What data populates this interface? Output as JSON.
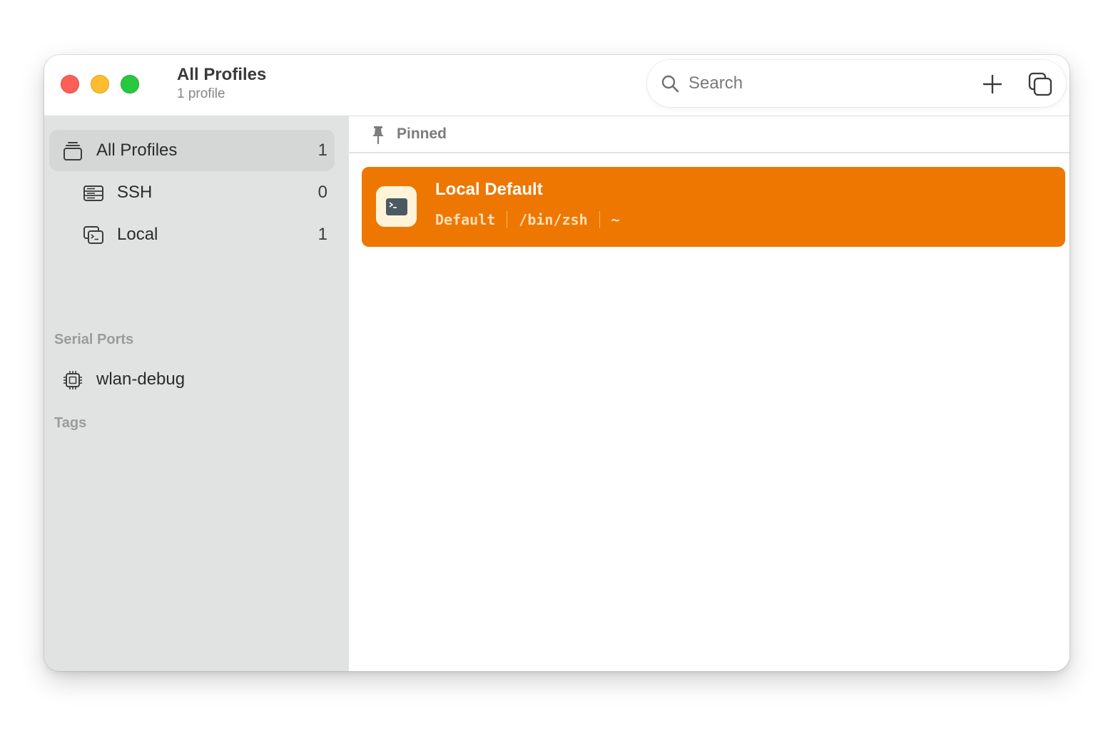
{
  "window": {
    "title": "All Profiles",
    "subtitle": "1 profile"
  },
  "toolbar": {
    "search_placeholder": "Search",
    "add_icon": "plus-icon",
    "duplicate_icon": "duplicate-icon"
  },
  "sidebar": {
    "items": [
      {
        "label": "All Profiles",
        "count": "1",
        "icon": "stack-icon",
        "selected": true
      },
      {
        "label": "SSH",
        "count": "0",
        "icon": "server-icon"
      },
      {
        "label": "Local",
        "count": "1",
        "icon": "terminal-windows-icon"
      }
    ],
    "serial_header": "Serial Ports",
    "serial_items": [
      {
        "label": "wlan-debug",
        "icon": "chip-icon"
      }
    ],
    "tags_header": "Tags"
  },
  "content": {
    "pinned_label": "Pinned",
    "profiles": [
      {
        "name": "Local Default",
        "icon": "terminal-icon",
        "meta": [
          "Default",
          "/bin/zsh",
          "~"
        ],
        "accent": "#ed7700"
      }
    ]
  }
}
